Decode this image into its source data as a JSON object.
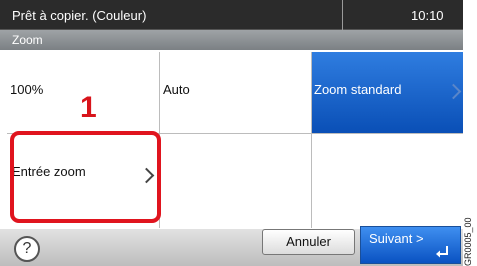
{
  "status": {
    "message": "Prêt à copier. (Couleur)",
    "time": "10:10"
  },
  "title": "Zoom",
  "options": {
    "percent_100": "100%",
    "auto": "Auto",
    "standard_zoom": "Zoom standard",
    "zoom_entry": "Entrée zoom"
  },
  "annotation": {
    "step": "1"
  },
  "buttons": {
    "help": "?",
    "cancel": "Annuler",
    "next": "Suivant >"
  },
  "figure_code": "GR0005_00",
  "colors": {
    "selected": "#1f6bd1",
    "highlight": "#e0141e"
  }
}
